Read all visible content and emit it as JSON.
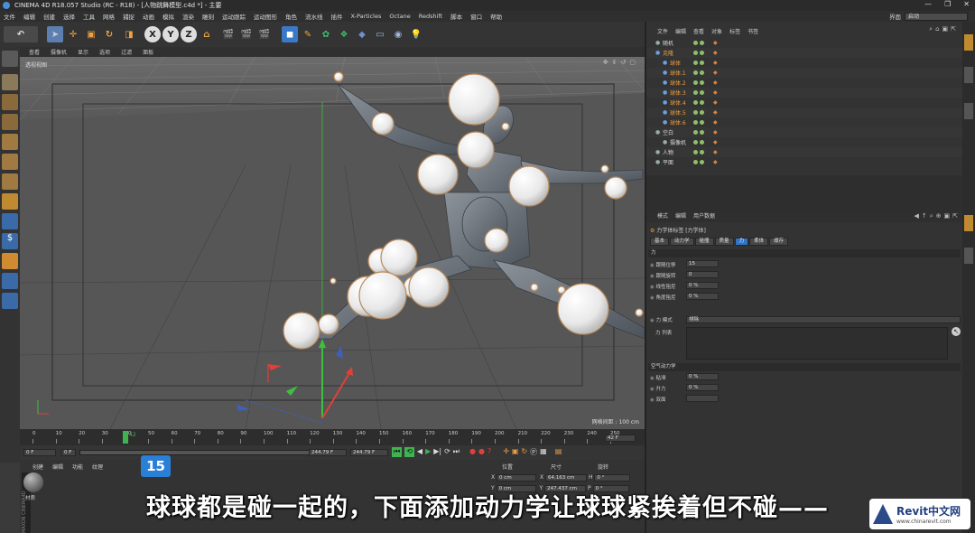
{
  "window": {
    "title": "CINEMA 4D R18.057 Studio (RC - R18) - [人物跳舞模型.c4d *] - 主要"
  },
  "menu": [
    "文件",
    "编辑",
    "创建",
    "选择",
    "工具",
    "网格",
    "捕捉",
    "动画",
    "模拟",
    "渲染",
    "雕刻",
    "运动跟踪",
    "运动图形",
    "角色",
    "流水线",
    "插件",
    "X-Particles",
    "Octane",
    "Redshift",
    "脚本",
    "窗口",
    "帮助"
  ],
  "layout": {
    "label": "界面",
    "value": "启动"
  },
  "viewport": {
    "menu": [
      "查看",
      "摄像机",
      "显示",
      "选项",
      "过滤",
      "面板"
    ],
    "camera_label": "透视视图",
    "grid_info": "网格间距 : 100 cm"
  },
  "timeline": {
    "ticks": [
      "0",
      "10",
      "20",
      "30",
      "40",
      "50",
      "60",
      "70",
      "80",
      "90",
      "100",
      "110",
      "120",
      "130",
      "140",
      "150",
      "160",
      "170",
      "180",
      "190",
      "200",
      "210",
      "220",
      "230",
      "240",
      "250"
    ],
    "current": "42",
    "frame_readout": "42 F"
  },
  "transport": {
    "start": "0 F",
    "range_start": "0 F",
    "range_end": "244.79 F",
    "end": "244.79 F"
  },
  "materials": {
    "menu": [
      "创建",
      "编辑",
      "功能",
      "纹理"
    ],
    "material_name": "材质"
  },
  "coords": {
    "headers": [
      "位置",
      "尺寸",
      "旋转"
    ],
    "rows": [
      {
        "axis": "X",
        "pos": "0 cm",
        "size": "64.163 cm",
        "rot_axis": "H",
        "rot": "0 °"
      },
      {
        "axis": "Y",
        "pos": "0 cm",
        "size": "247.437 cm",
        "rot_axis": "P",
        "rot": "0 °"
      }
    ]
  },
  "object_manager": {
    "menu": [
      "文件",
      "编辑",
      "查看",
      "对象",
      "标签",
      "书签"
    ],
    "objects": [
      {
        "name": "随机",
        "indent": 0,
        "color": "#d8d8d8"
      },
      {
        "name": "克隆",
        "indent": 0,
        "color": "#f0a040"
      },
      {
        "name": "球体",
        "indent": 1,
        "color": "#f0a040"
      },
      {
        "name": "球体.1",
        "indent": 1,
        "color": "#f0a040"
      },
      {
        "name": "球体.2",
        "indent": 1,
        "color": "#f0a040"
      },
      {
        "name": "球体.3",
        "indent": 1,
        "color": "#f0a040"
      },
      {
        "name": "球体.4",
        "indent": 1,
        "color": "#f0a040"
      },
      {
        "name": "球体.5",
        "indent": 1,
        "color": "#f0a040"
      },
      {
        "name": "球体.6",
        "indent": 1,
        "color": "#f0a040"
      },
      {
        "name": "空白",
        "indent": 0,
        "color": "#d8d8d8"
      },
      {
        "name": "摄像机",
        "indent": 1,
        "color": "#d8d8d8"
      },
      {
        "name": "人物",
        "indent": 0,
        "color": "#d8d8d8"
      },
      {
        "name": "平面",
        "indent": 0,
        "color": "#d8d8d8"
      }
    ]
  },
  "attributes": {
    "menu": [
      "模式",
      "编辑",
      "用户数据"
    ],
    "header": "力学体标签 [力学体]",
    "tabs": [
      "基本",
      "动力学",
      "碰撞",
      "质量",
      "力",
      "柔体",
      "缓存"
    ],
    "active_tab": "力",
    "section_force": "力",
    "fields": [
      {
        "label": "跟随位移",
        "value": "15"
      },
      {
        "label": "跟随旋转",
        "value": "0"
      },
      {
        "label": "线性阻尼",
        "value": "0 %"
      },
      {
        "label": "角度阻尼",
        "value": "0 %"
      }
    ],
    "force_mode_label": "力 模式",
    "force_mode_value": "排除",
    "force_list_label": "力 列表",
    "section_aero": "空气动力学",
    "aero_fields": [
      {
        "label": "粘滞",
        "value": "0 %"
      },
      {
        "label": "升力",
        "value": "0 %"
      },
      {
        "label": "双面",
        "value": ""
      }
    ]
  },
  "overlay": {
    "step_number": "15",
    "subtitle": "球球都是碰一起的，下面添加动力学让球球紧挨着但不碰——",
    "watermark_brand": "Revit中文网",
    "watermark_url": "www.chinarevit.com"
  },
  "colors": {
    "accent": "#2f74c9",
    "orange": "#f0a040",
    "timeline_marker": "#3fb34f"
  }
}
